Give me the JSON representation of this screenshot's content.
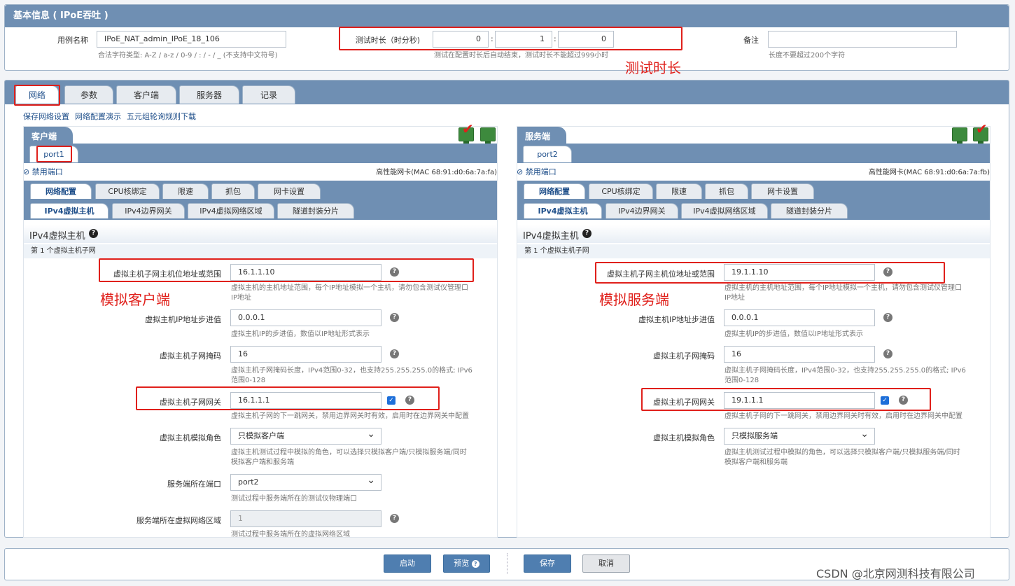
{
  "basic": {
    "title": "基本信息 ( IPoE吞吐 )",
    "case_name_label": "用例名称",
    "case_name_value": "IPoE_NAT_admin_IPoE_18_106",
    "case_name_hint": "合法字符类型: A-Z / a-z / 0-9 / : / - / _ (不支持中文符号)",
    "duration_label": "测试时长（时分秒)",
    "duration_h": "0",
    "duration_m": "1",
    "duration_s": "0",
    "duration_sep": ":",
    "duration_hint": "测试在配置时长后自动结束，测试时长不能超过999小时",
    "remark_label": "备注",
    "remark_value": "",
    "remark_hint": "长度不要超过200个字符",
    "annot_duration": "测试时长"
  },
  "main_tabs": [
    "网络",
    "参数",
    "客户端",
    "服务器",
    "记录"
  ],
  "links": [
    "保存网络设置",
    "网络配置演示",
    "五元组轮询规则下载"
  ],
  "client": {
    "header": "客户端",
    "port_tab": "port1",
    "disable_link": "禁用端口",
    "nic": "高性能网卡(MAC 68:91:d0:6a:7a:fa)",
    "annot": "模拟客户端",
    "ip_range": "16.1.1.10",
    "step": "0.0.0.1",
    "mask": "16",
    "gateway": "16.1.1.1",
    "role": "只模拟客户端",
    "server_port_label": "服务端所在端口",
    "server_port": "port2",
    "server_port_hint": "测试过程中服务端所在的测试仪物理端口",
    "server_zone_label": "服务端所在虚拟网络区域",
    "server_zone": "1",
    "server_zone_hint": "测试过程中服务端所在的虚拟网络区域"
  },
  "server": {
    "header": "服务端",
    "port_tab": "port2",
    "disable_link": "禁用端口",
    "nic": "高性能网卡(MAC 68:91:d0:6a:7a:fb)",
    "annot": "模拟服务端",
    "ip_range": "19.1.1.10",
    "step": "0.0.0.1",
    "mask": "16",
    "gateway": "19.1.1.1",
    "role": "只模拟服务端"
  },
  "sub_tabs": [
    "网络配置",
    "CPU核绑定",
    "限速",
    "抓包",
    "网卡设置"
  ],
  "ipv4_tabs": [
    "IPv4虚拟主机",
    "IPv4边界网关",
    "IPv4虚拟网络区域",
    "隧道封装分片"
  ],
  "form": {
    "section_title": "IPv4虚拟主机",
    "subnet_title": "第 1 个虚拟主机子网",
    "ip_range_label": "虚拟主机子网主机位地址或范围",
    "ip_range_hint1": "虚拟主机的主机地址范围，每个IP地址模拟一个主机，请勿包含测试仪管理口",
    "ip_range_hint2": "IP地址",
    "step_label": "虚拟主机IP地址步进值",
    "step_hint": "虚拟主机IP的步进值，数值以IP地址形式表示",
    "mask_label": "虚拟主机子网掩码",
    "mask_hint1": "虚拟主机子网掩码长度，IPv4范围0-32，也支持255.255.255.0的格式; IPv6",
    "mask_hint2": "范围0-128",
    "gw_label": "虚拟主机子网网关",
    "gw_hint": "虚拟主机子网的下一跳网关，禁用边界网关时有效，启用时在边界网关中配置",
    "role_label": "虚拟主机模拟角色",
    "role_hint1": "虚拟主机测试过程中模拟的角色，可以选择只模拟客户端/只模拟服务端/同时",
    "role_hint2": "模拟客户端和服务端"
  },
  "footer": {
    "start": "启动",
    "preview": "预览",
    "save": "保存",
    "cancel": "取消"
  },
  "watermark": "CSDN @北京网测科技有限公司"
}
